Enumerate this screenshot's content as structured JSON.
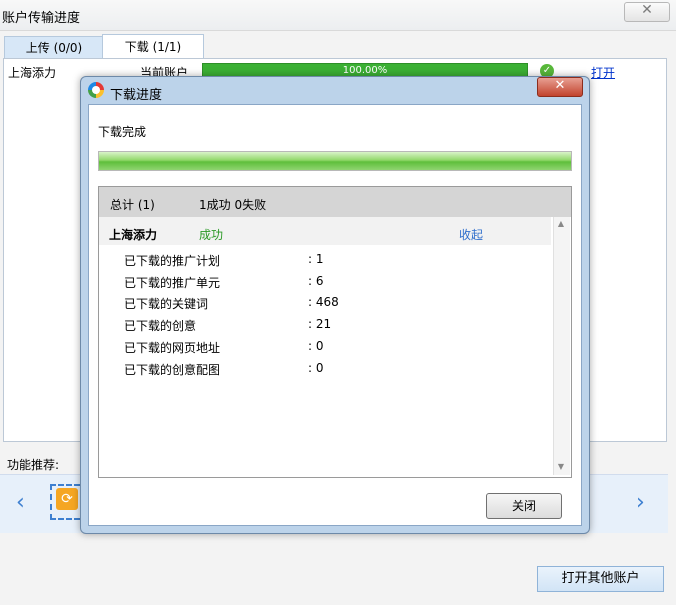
{
  "outer": {
    "title": "账户传输进度",
    "close_glyph": "✕",
    "tabs": [
      {
        "label": "上传 (0/0)"
      },
      {
        "label": "下载 (1/1)"
      }
    ],
    "row": {
      "account": "上海添力",
      "current": "当前账户",
      "progress_text": "100.00%",
      "progress": 1.0,
      "status_icon": "check-circle-icon",
      "open_link": "打开"
    },
    "function_label": "功能推荐:",
    "nav_left": "‹",
    "nav_right": "›",
    "open_other_button": "打开其他账户"
  },
  "dialog": {
    "title": "下载进度",
    "close_glyph": "✕",
    "status": "下载完成",
    "progress": 1.0,
    "summary": {
      "label": "总计 (1)",
      "result": "1成功  0失败"
    },
    "account": {
      "name": "上海添力",
      "status": "成功",
      "collapse_link": "收起"
    },
    "stats": [
      {
        "label": "已下载的推广计划",
        "value": ": 1"
      },
      {
        "label": "已下载的推广单元",
        "value": ": 6"
      },
      {
        "label": "已下载的关键词",
        "value": ": 468"
      },
      {
        "label": "已下载的创意",
        "value": ": 21"
      },
      {
        "label": "已下载的网页地址",
        "value": ": 0"
      },
      {
        "label": "已下载的创意配图",
        "value": ": 0"
      }
    ],
    "close_button": "关闭"
  },
  "colors": {
    "progress_green": "#3bb034",
    "success_green": "#2b9a26",
    "link_blue": "#2f6ecc"
  }
}
